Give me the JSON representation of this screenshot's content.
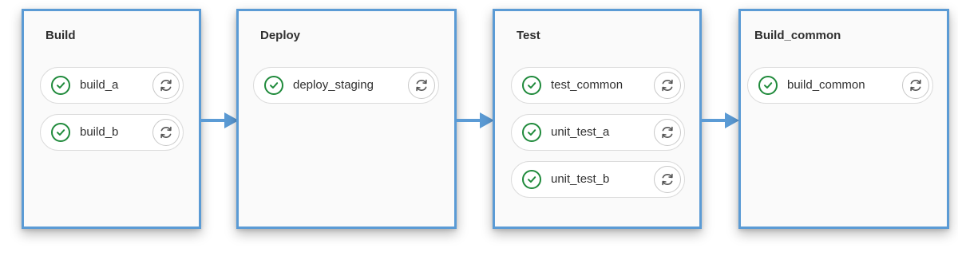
{
  "pipeline": {
    "stages": [
      {
        "title": "Build",
        "jobs": [
          {
            "name": "build_a",
            "status": "success"
          },
          {
            "name": "build_b",
            "status": "success"
          }
        ]
      },
      {
        "title": "Deploy",
        "jobs": [
          {
            "name": "deploy_staging",
            "status": "success"
          }
        ]
      },
      {
        "title": "Test",
        "jobs": [
          {
            "name": "test_common",
            "status": "success"
          },
          {
            "name": "unit_test_a",
            "status": "success"
          },
          {
            "name": "unit_test_b",
            "status": "success"
          }
        ]
      },
      {
        "title": "Build_common",
        "jobs": [
          {
            "name": "build_common",
            "status": "success"
          }
        ]
      }
    ]
  },
  "icons": {
    "status": "check-circle-icon",
    "retry": "retry-icon",
    "connector": "arrow-right-icon"
  },
  "colors": {
    "stage_border": "#5b9bd5",
    "success": "#1f8a3b",
    "connector": "#5b9bd5"
  }
}
